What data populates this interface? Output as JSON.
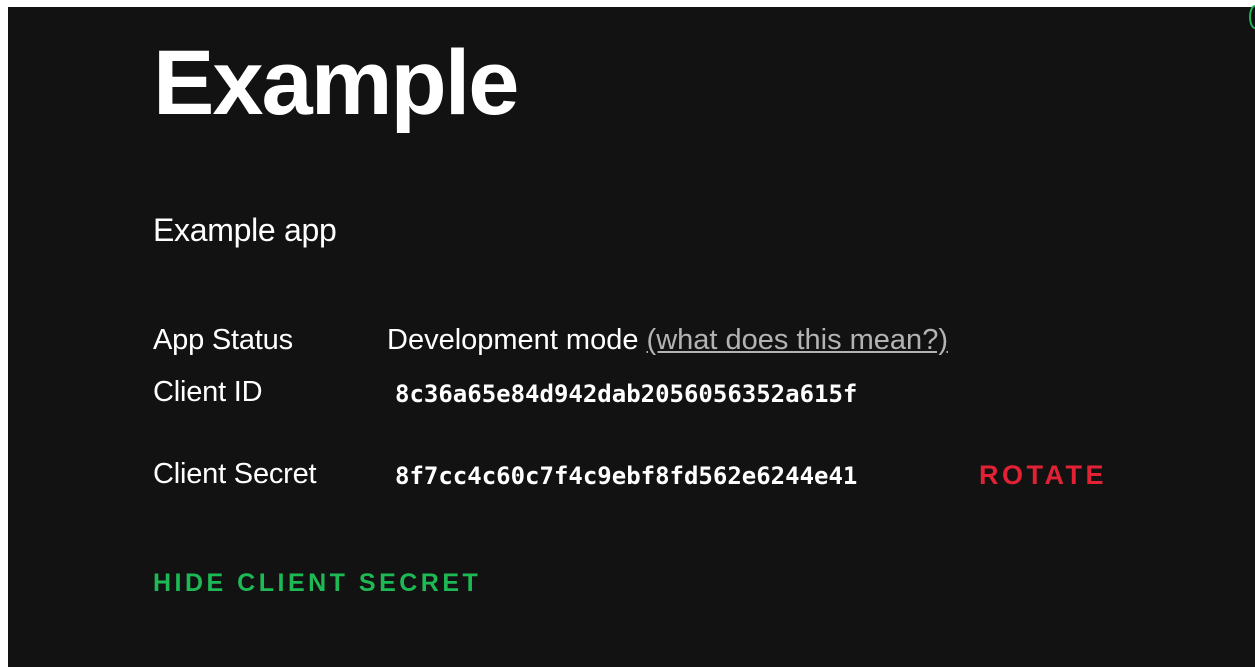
{
  "app": {
    "title": "Example",
    "description": "Example app"
  },
  "details": {
    "status_label": "App Status",
    "status_value": "Development mode",
    "status_help_link": "(what does this mean?)",
    "client_id_label": "Client ID",
    "client_id_value": "8c36a65e84d942dab2056056352a615f",
    "client_secret_label": "Client Secret",
    "client_secret_value": "8f7cc4c60c7f4c9ebf8fd562e6244e41",
    "rotate_label": "ROTATE"
  },
  "actions": {
    "hide_secret_label": "HIDE CLIENT SECRET"
  },
  "colors": {
    "background": "#121212",
    "text": "#ffffff",
    "link": "#b3b3b3",
    "danger": "#e22134",
    "accent": "#1db954"
  }
}
